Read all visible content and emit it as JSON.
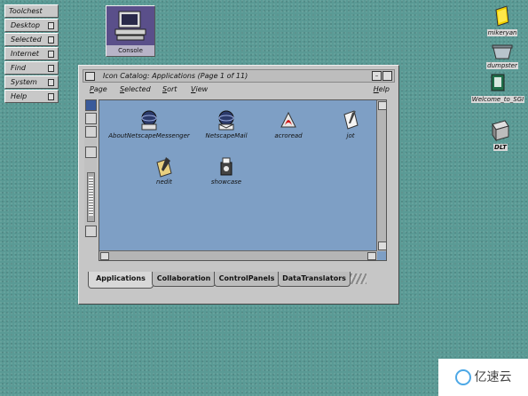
{
  "toolchest": {
    "title": "Toolchest",
    "items": [
      "Desktop",
      "Selected",
      "Internet",
      "Find",
      "System",
      "Help"
    ]
  },
  "console": {
    "label": "Console"
  },
  "desktop_icons": [
    {
      "label": "mikeryan",
      "icon": "folder-icon"
    },
    {
      "label": "dumpster",
      "icon": "trash-icon"
    },
    {
      "label": "Welcome_to_SGI",
      "icon": "sgi-welcome-icon"
    },
    {
      "label": "DLT",
      "icon": "tape-drive-icon"
    }
  ],
  "window": {
    "title": "Icon Catalog: Applications (Page 1 of 11)",
    "menus": [
      "Page",
      "Selected",
      "Sort",
      "View"
    ],
    "help_menu": "Help",
    "icons": [
      {
        "label": "AboutNetscapeMessenger",
        "icon": "netscape-icon"
      },
      {
        "label": "NetscapeMail",
        "icon": "netscape-mail-icon"
      },
      {
        "label": "acroread",
        "icon": "acrobat-icon"
      },
      {
        "label": "jot",
        "icon": "jot-editor-icon"
      },
      {
        "label": "nedit",
        "icon": "nedit-icon"
      },
      {
        "label": "showcase",
        "icon": "showcase-icon"
      }
    ],
    "tabs": [
      "Applications",
      "Collaboration",
      "ControlPanels",
      "DataTranslators"
    ],
    "active_tab": "Applications"
  },
  "watermark": {
    "text": "亿速云"
  }
}
